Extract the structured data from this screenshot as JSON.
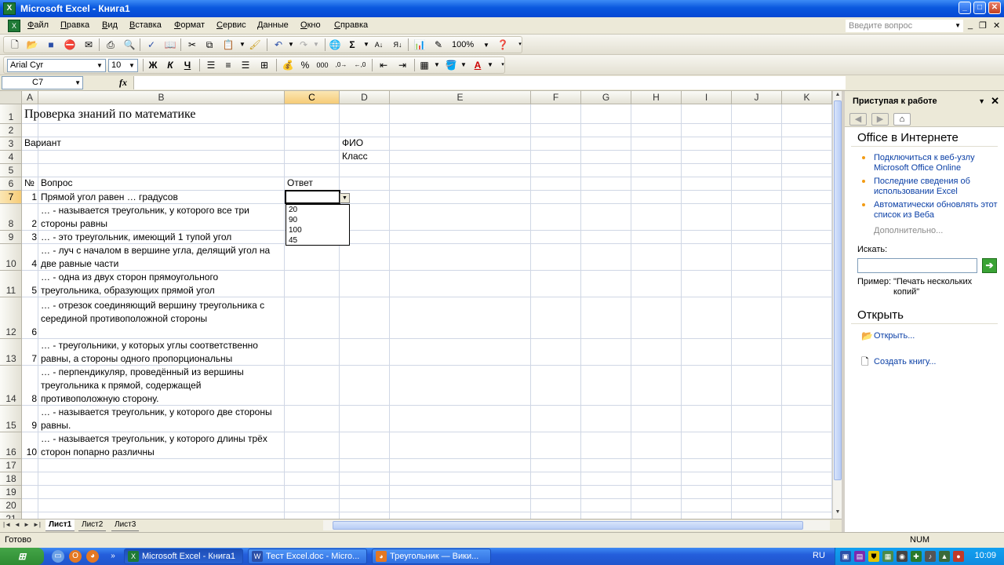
{
  "window": {
    "title": "Microsoft Excel - Книга1",
    "min": "_",
    "max": "□",
    "close": "✕"
  },
  "menu": {
    "items": [
      "Файл",
      "Правка",
      "Вид",
      "Вставка",
      "Формат",
      "Сервис",
      "Данные",
      "Окно",
      "Справка"
    ],
    "ask_placeholder": "Введите вопрос",
    "mdi_min": "_",
    "mdi_restore": "❐",
    "mdi_close": "✕"
  },
  "toolbar1": {
    "zoom": "100%"
  },
  "toolbar2": {
    "font": "Arial Cyr",
    "size": "10",
    "bold": "Ж",
    "italic": "К",
    "underline": "Ч"
  },
  "formula": {
    "cell_ref": "C7",
    "fx": "fx",
    "value": ""
  },
  "grid": {
    "columns": [
      "A",
      "B",
      "C",
      "D",
      "E",
      "F",
      "G",
      "H",
      "I",
      "J",
      "K"
    ],
    "selected_column": "C",
    "selected_row": "7",
    "rows": [
      "1",
      "2",
      "3",
      "4",
      "5",
      "6",
      "7",
      "8",
      "9",
      "10",
      "11",
      "12",
      "13",
      "14",
      "15",
      "16",
      "17",
      "18",
      "19",
      "20",
      "21"
    ],
    "title": "Проверка знаний по математике",
    "variant_label": "Вариант",
    "fio_label": "ФИО",
    "class_label": "Класс",
    "col_num": "№",
    "col_question": "Вопрос",
    "col_answer": "Ответ",
    "questions": [
      {
        "n": "1",
        "text": "Прямой угол равен … градусов"
      },
      {
        "n": "2",
        "text": "… - называется треугольник, у которого все три стороны равны"
      },
      {
        "n": "3",
        "text": "… - это треугольник, имеющий 1 тупой угол"
      },
      {
        "n": "4",
        "text": "… - луч с началом в вершине угла, делящий угол на две равные части"
      },
      {
        "n": "5",
        "text": "… - одна из двух сторон прямоугольного треугольника, образующих прямой угол"
      },
      {
        "n": "6",
        "text": "… - отрезок соединяющий вершину треугольника с серединой противоположной стороны"
      },
      {
        "n": "7",
        "text": "… - треугольники, у которых углы соответственно равны, а стороны одного пропорциональны"
      },
      {
        "n": "8",
        "text": "… - перпендикуляр, проведённый из вершины треугольника к прямой, содержащей противоположную сторону."
      },
      {
        "n": "9",
        "text": "… - называется треугольник, у которого две стороны равны."
      },
      {
        "n": "10",
        "text": "… - называется треугольник, у которого длины трёх сторон попарно различны"
      }
    ],
    "dropdown_options": [
      "20",
      "90",
      "100",
      "45"
    ]
  },
  "sheets": {
    "tabs": [
      "Лист1",
      "Лист2",
      "Лист3"
    ],
    "active": "Лист1"
  },
  "taskpane": {
    "title": "Приступая к работе",
    "office_online": "Office в Интернете",
    "links": [
      "Подключиться к веб-узлу Microsoft Office Online",
      "Последние сведения об использовании Excel",
      "Автоматически обновлять этот список из Веба"
    ],
    "more": "Дополнительно...",
    "search_label": "Искать:",
    "search_value": "",
    "example_label": "Пример:",
    "example_text": "\"Печать нескольких копий\"",
    "open_heading": "Открыть",
    "open_link": "Открыть...",
    "create_link": "Создать книгу..."
  },
  "status": {
    "left": "Готово",
    "num": "NUM"
  },
  "taskbar": {
    "start": "пуск",
    "buttons": [
      "Microsoft Excel - Книга1",
      "Тест Excel.doc - Micro...",
      "Треугольник — Вики..."
    ],
    "lang": "RU",
    "clock": "10:09"
  },
  "colors": {
    "title_blue": "#0a58de",
    "selection": "#f6cc77",
    "link": "#0a3fa6",
    "excel_green": "#1f7a36"
  }
}
